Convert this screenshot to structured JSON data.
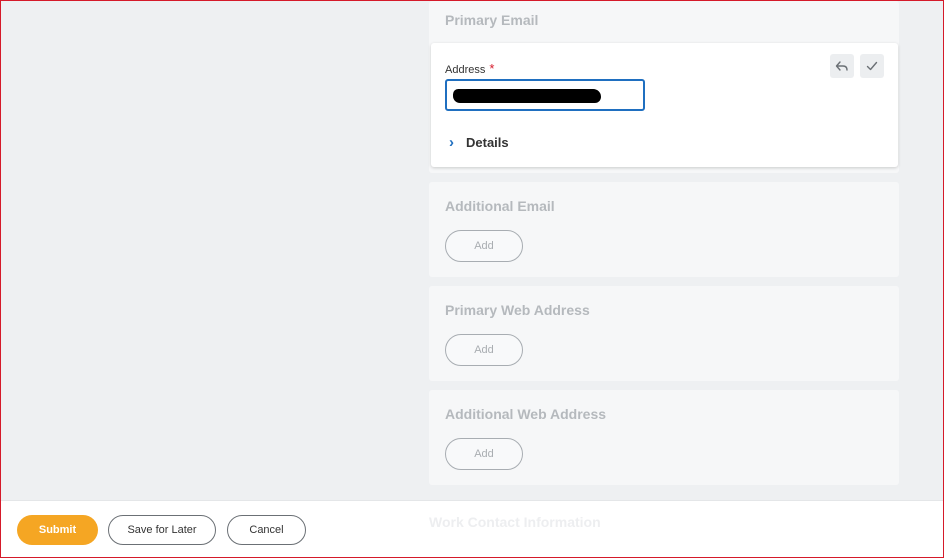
{
  "primary_email": {
    "title": "Primary Email",
    "address_label": "Address",
    "required_marker": "*",
    "address_value": "",
    "details_label": "Details",
    "chevron_glyph": "›",
    "icons": {
      "undo": "undo-arrow-icon",
      "confirm": "checkmark-icon"
    }
  },
  "additional_email": {
    "title": "Additional Email",
    "add_label": "Add"
  },
  "primary_web_address": {
    "title": "Primary Web Address",
    "add_label": "Add"
  },
  "additional_web_address": {
    "title": "Additional Web Address",
    "add_label": "Add"
  },
  "footer": {
    "submit_label": "Submit",
    "save_label": "Save for Later",
    "cancel_label": "Cancel",
    "next_section_title": "Work Contact Information"
  },
  "colors": {
    "accent_blue": "#1f6fc0",
    "submit_orange": "#f5a623",
    "required_red": "#d51a2a",
    "frame_border": "#d51a2a"
  }
}
